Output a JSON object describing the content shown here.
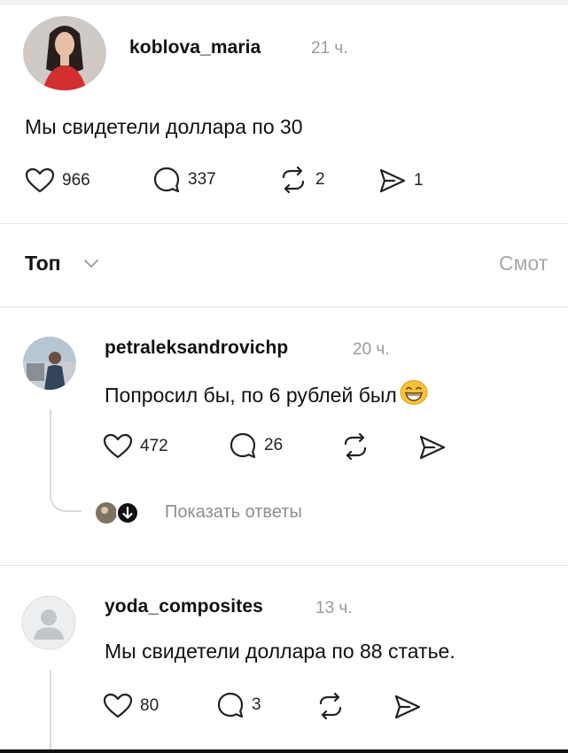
{
  "post": {
    "username": "koblova_maria",
    "time": "21 ч.",
    "text": "Мы свидетели доллара по 30",
    "likes": "966",
    "comments": "337",
    "reposts": "2",
    "shares": "1"
  },
  "sort": {
    "label": "Топ",
    "view_label": "Смот"
  },
  "comments": [
    {
      "username": "petraleksandrovichp",
      "time": "20 ч.",
      "text": "Попросил бы, по 6 рублей был",
      "emoji": "grinning-face-icon",
      "likes": "472",
      "comments": "26",
      "show_replies": "Показать ответы"
    },
    {
      "username": "yoda_composites",
      "time": "13 ч.",
      "text": "Мы свидетели доллара по 88 статье.",
      "likes": "80",
      "comments": "3"
    }
  ],
  "colors": {
    "text": "#111111",
    "muted": "#9b9b9b",
    "divider": "#e3e3e3",
    "avatar_accent": "#d32f2f"
  }
}
